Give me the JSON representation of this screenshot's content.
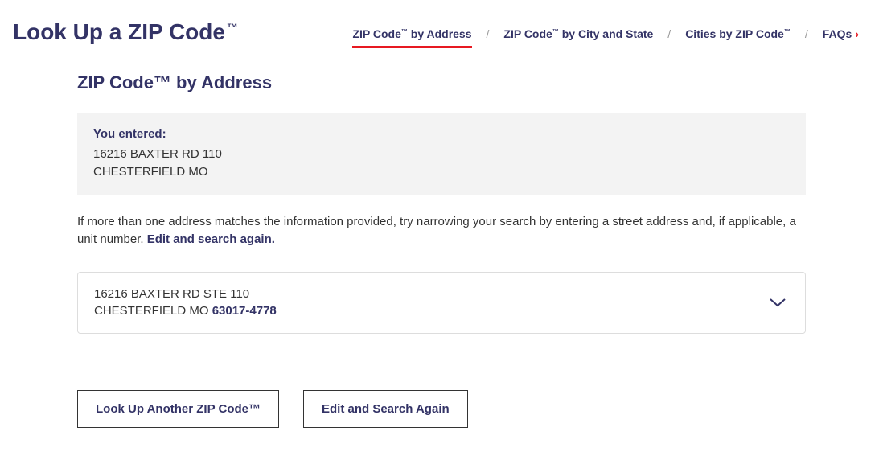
{
  "header": {
    "title_pre": "Look Up a ZIP Code",
    "title_tm": "™"
  },
  "tabs": {
    "items": [
      {
        "label_pre": "ZIP Code",
        "label_tm": "™",
        "label_post": " by Address"
      },
      {
        "label_pre": "ZIP Code",
        "label_tm": "™",
        "label_post": " by City and State"
      },
      {
        "label_pre": "Cities by ZIP Code",
        "label_tm": "™",
        "label_post": ""
      }
    ],
    "faq_label": "FAQs",
    "separator": "/"
  },
  "section": {
    "heading": "ZIP Code™ by Address"
  },
  "entered": {
    "label": "You entered:",
    "line1": "16216 BAXTER RD 110",
    "line2": "CHESTERFIELD MO"
  },
  "hint": {
    "text": "If more than one address matches the information provided, try narrowing your search by entering a street address and, if applicable, a unit number. ",
    "link": "Edit and search again."
  },
  "result": {
    "line1": "16216 BAXTER RD STE 110",
    "line2_pre": "CHESTERFIELD MO ",
    "zip": "63017-4778"
  },
  "actions": {
    "lookup_label": "Look Up Another ZIP Code™",
    "edit_label": "Edit and Search Again"
  }
}
